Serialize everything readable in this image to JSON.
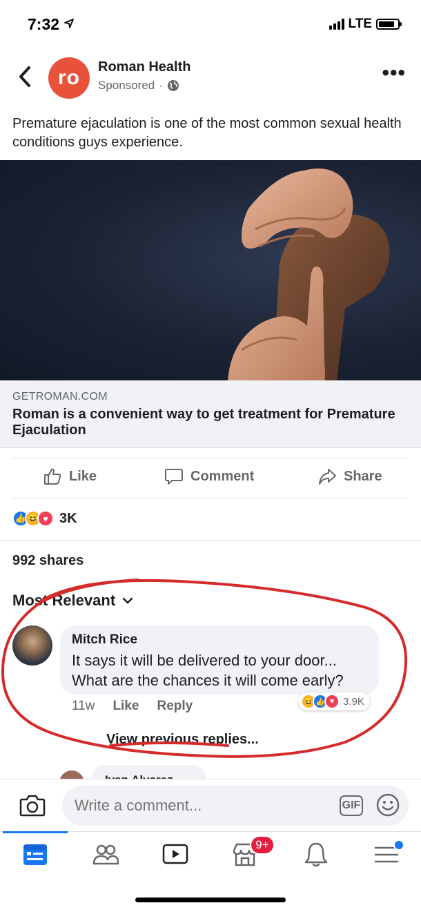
{
  "status_bar": {
    "time": "7:32",
    "network": "LTE"
  },
  "post": {
    "page_name": "Roman Health",
    "avatar_text": "ro",
    "sponsored": "Sponsored",
    "text": "Premature ejaculation is one of the most common sexual health conditions guys experience.",
    "image_icon": "hands-photo",
    "link": {
      "domain": "GETROMAN.COM",
      "title": "Roman is a convenient way to get treatment for Premature Ejaculation"
    }
  },
  "actions": {
    "like": "Like",
    "comment": "Comment",
    "share": "Share"
  },
  "stats": {
    "reactions_count": "3K",
    "shares": "992 shares"
  },
  "comments": {
    "sort_label": "Most Relevant",
    "items": [
      {
        "author": "Mitch Rice",
        "text": "It says it will be delivered to your door... What are the chances it will come early?",
        "time": "11w",
        "like": "Like",
        "reply": "Reply",
        "reactions_count": "3.9K"
      }
    ],
    "view_previous": "View previous replies...",
    "next_author": "Ivan Alvarez"
  },
  "composer": {
    "placeholder": "Write a comment...",
    "gif": "GIF"
  },
  "tabbar": {
    "marketplace_badge": "9+"
  },
  "colors": {
    "brand_orange": "#e8513a",
    "facebook_blue": "#1877f2",
    "annotation_red": "#d42b2b",
    "badge_red": "#e41e3f"
  }
}
